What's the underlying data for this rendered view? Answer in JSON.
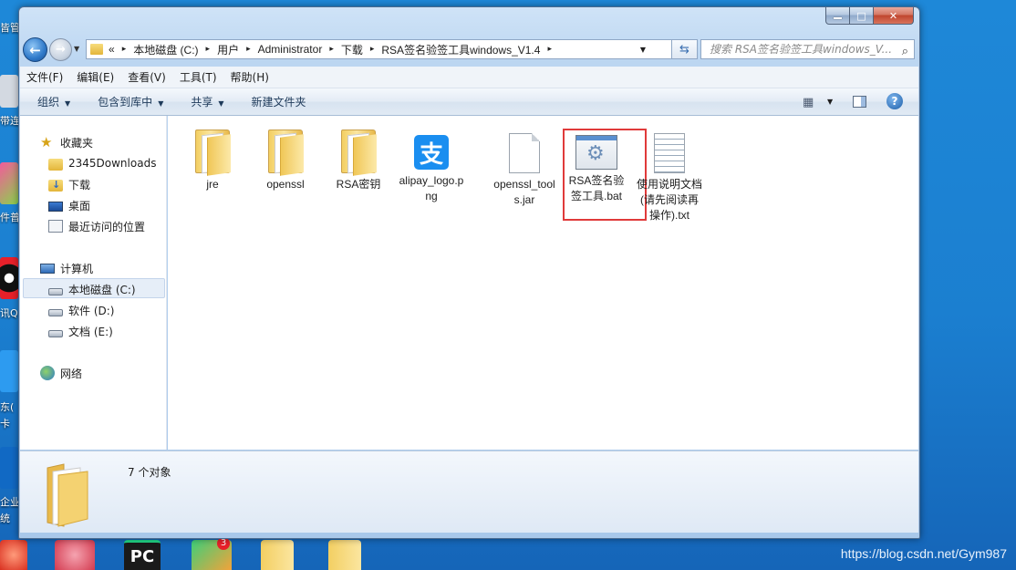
{
  "window": {
    "caption_minimize": "—",
    "caption_maximize": "□",
    "caption_close": "✕"
  },
  "address": {
    "breadcrumbs": [
      "«",
      "本地磁盘 (C:)",
      "用户",
      "Administrator",
      "下载",
      "RSA签名验签工具windows_V1.4"
    ],
    "search_placeholder": "搜索 RSA签名验签工具windows_V..."
  },
  "menu": [
    "文件(F)",
    "编辑(E)",
    "查看(V)",
    "工具(T)",
    "帮助(H)"
  ],
  "toolbar": {
    "organize": "组织",
    "include_in_library": "包含到库中",
    "share": "共享",
    "new_folder": "新建文件夹",
    "help": "?"
  },
  "sidebar": {
    "favorites_header": "收藏夹",
    "favorites": [
      "2345Downloads",
      "下载",
      "桌面",
      "最近访问的位置"
    ],
    "computer_header": "计算机",
    "drives": [
      "本地磁盘 (C:)",
      "软件 (D:)",
      "文档 (E:)"
    ],
    "network_header": "网络"
  },
  "files": [
    {
      "name": "jre",
      "type": "folder"
    },
    {
      "name": "openssl",
      "type": "folder"
    },
    {
      "name": "RSA密钥",
      "type": "folder"
    },
    {
      "name": "alipay_logo.png",
      "type": "png",
      "icon_glyph": "支"
    },
    {
      "name": "openssl_tools.jar",
      "type": "jar"
    },
    {
      "name": "RSA签名验签工具.bat",
      "type": "bat",
      "selected": true
    },
    {
      "name": "使用说明文档(请先阅读再操作).txt",
      "type": "txt"
    }
  ],
  "details": {
    "item_count": "7 个对象"
  },
  "desktop_labels": [
    "皆管",
    "带连",
    "件普",
    "讯Q",
    "东(",
    "卡",
    "企业",
    "统"
  ],
  "taskbar": {
    "pc_label": "PC",
    "badge_count": "3"
  },
  "watermark": "https://blog.csdn.net/Gym987",
  "colors": {
    "accent": "#1a8ef0",
    "highlight_border": "#e03a3a",
    "desktop_bg": "#1b7fd0"
  }
}
